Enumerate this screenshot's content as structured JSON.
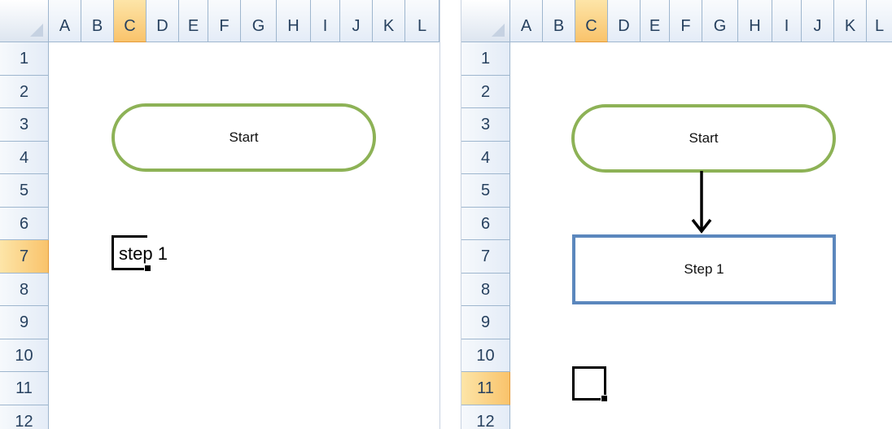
{
  "columns": [
    "A",
    "B",
    "C",
    "D",
    "E",
    "F",
    "G",
    "H",
    "I",
    "J",
    "K",
    "L"
  ],
  "rows": [
    "1",
    "2",
    "3",
    "4",
    "5",
    "6",
    "7",
    "8",
    "9",
    "10",
    "11",
    "12"
  ],
  "left_sheet": {
    "active_column": "C",
    "active_row": "7",
    "start_shape_label": "Start",
    "cell_text": "step 1"
  },
  "right_sheet": {
    "active_column": "C",
    "active_row": "11",
    "start_shape_label": "Start",
    "step_shape_label": "Step 1"
  },
  "colors": {
    "terminator_border": "#8db256",
    "process_border": "#5b87bd",
    "active_header": "#f9c36b",
    "header_text": "#27415f"
  }
}
